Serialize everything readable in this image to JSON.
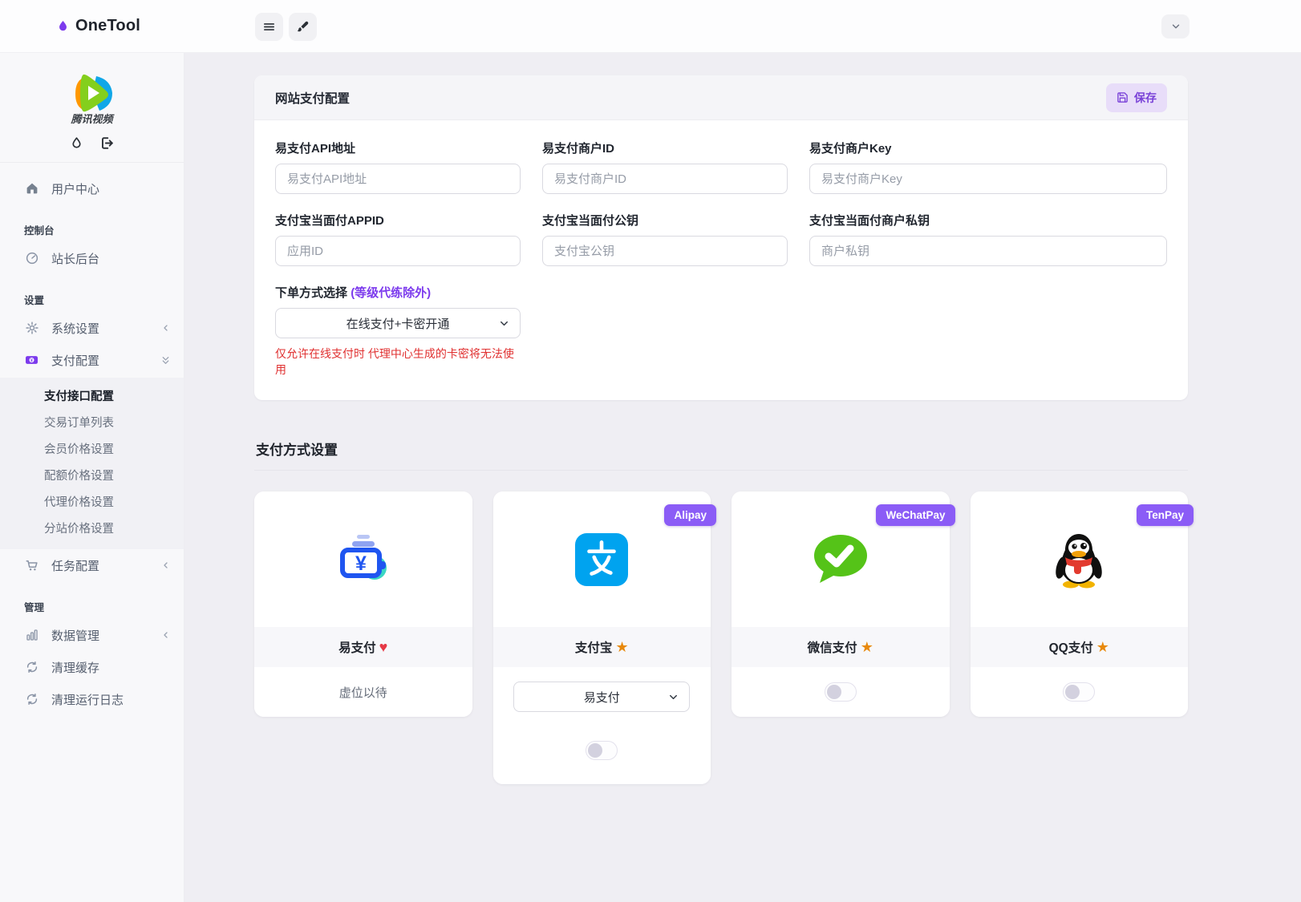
{
  "header": {
    "brand": "OneTool"
  },
  "sidebar": {
    "logo_caption": "腾讯视频",
    "nav": {
      "user_center": "用户中心",
      "section_console": "控制台",
      "webmaster": "站长后台",
      "section_settings": "设置",
      "system_settings": "系统设置",
      "payment_config": "支付配置",
      "task_config": "任务配置",
      "section_manage": "管理",
      "data_manage": "数据管理",
      "clear_cache": "清理缓存",
      "clear_logs": "清理运行日志"
    },
    "payment_submenu": [
      "支付接口配置",
      "交易订单列表",
      "会员价格设置",
      "配额价格设置",
      "代理价格设置",
      "分站价格设置"
    ]
  },
  "payment_form": {
    "title": "网站支付配置",
    "save_label": "保存",
    "fields": [
      {
        "label": "易支付API地址",
        "placeholder": "易支付API地址"
      },
      {
        "label": "易支付商户ID",
        "placeholder": "易支付商户ID"
      },
      {
        "label": "易支付商户Key",
        "placeholder": "易支付商户Key"
      },
      {
        "label": "支付宝当面付APPID",
        "placeholder": "应用ID"
      },
      {
        "label": "支付宝当面付公钥",
        "placeholder": "支付宝公钥"
      },
      {
        "label": "支付宝当面付商户私钥",
        "placeholder": "商户私钥"
      }
    ],
    "order_method": {
      "label": "下单方式选择",
      "label_note": "(等级代练除外)",
      "selected": "在线支付+卡密开通",
      "warning": "仅允许在线支付时 代理中心生成的卡密将无法使用"
    }
  },
  "payment_methods": {
    "title": "支付方式设置",
    "cards": [
      {
        "name": "易支付",
        "suffix": "♥",
        "note": "虚位以待"
      },
      {
        "name": "支付宝",
        "suffix": "★",
        "badge": "Alipay",
        "channel": "易支付",
        "toggle": "off"
      },
      {
        "name": "微信支付",
        "suffix": "★",
        "badge": "WeChatPay",
        "toggle": "off"
      },
      {
        "name": "QQ支付",
        "suffix": "★",
        "badge": "TenPay",
        "toggle": "off"
      }
    ]
  },
  "colors": {
    "accent": "#7c3aed",
    "badge": "#8b5cf6",
    "warning": "#e03131",
    "heart": "#e63946",
    "star": "#e8890c",
    "alipay_blue": "#00a3ef",
    "wechat_green": "#55c318",
    "yipay_blue": "#1f55f0",
    "yipay_teal": "#3bd6c3"
  }
}
